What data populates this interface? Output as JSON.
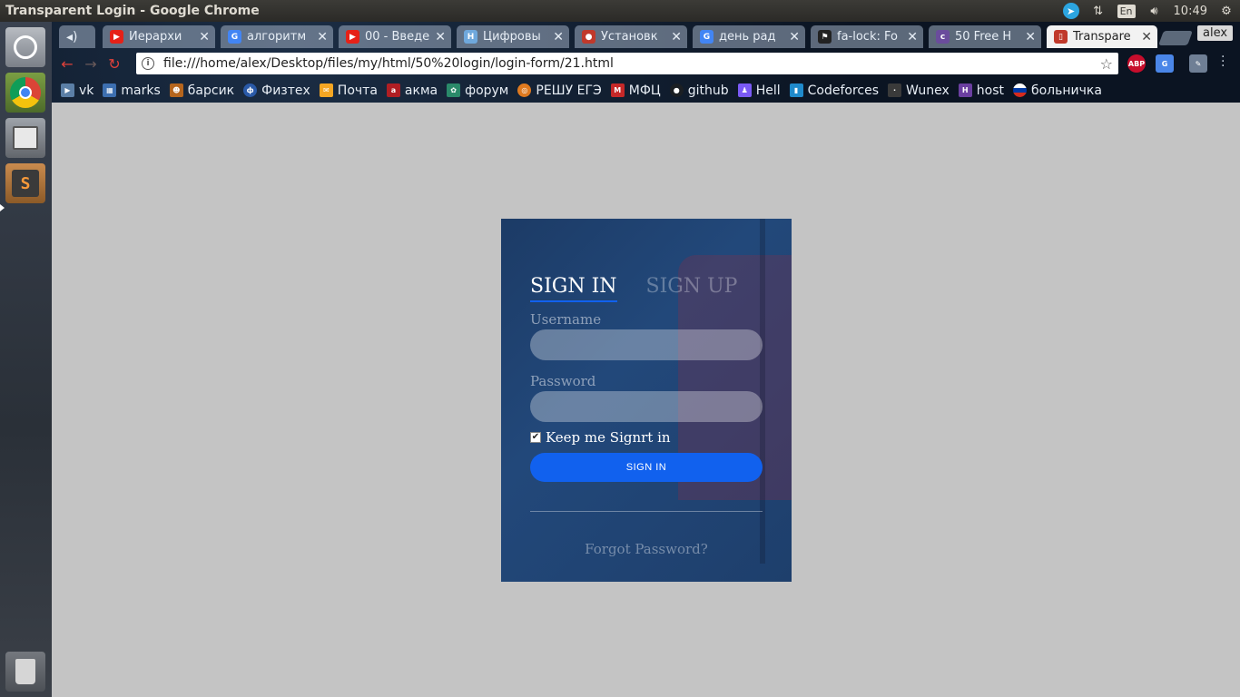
{
  "window": {
    "title": "Transparent Login - Google Chrome"
  },
  "tray": {
    "lang": "En",
    "time": "10:49"
  },
  "launcher": {
    "items": [
      {
        "name": "dash"
      },
      {
        "name": "google-chrome"
      },
      {
        "name": "files"
      },
      {
        "name": "sublime-text",
        "letter": "S"
      },
      {
        "name": "trash"
      }
    ]
  },
  "tabs": [
    {
      "label": "Иерархи",
      "fav_color": "#e62117"
    },
    {
      "label": "алгоритм",
      "fav_color": "#4285f4"
    },
    {
      "label": "00 - Введе",
      "fav_color": "#e62117"
    },
    {
      "label": "Цифровы",
      "fav_color": "#6fa8dc",
      "fav_letter": "H"
    },
    {
      "label": "Установк",
      "fav_color": "#c0392b"
    },
    {
      "label": "день рад",
      "fav_color": "#4285f4"
    },
    {
      "label": "fa-lock: Fo",
      "fav_color": "#222222"
    },
    {
      "label": "50 Free H",
      "fav_color": "#6a4c9c"
    },
    {
      "label": "Transpare",
      "fav_color": "#c0392b",
      "active": true
    }
  ],
  "user": "alex",
  "address": {
    "url": "file:///home/alex/Desktop/files/my/html/50%20login/login-form/21.html"
  },
  "extensions": {
    "abp": "ABP"
  },
  "bookmarks": [
    {
      "label": "vk",
      "fav_color": "#5b7fa6"
    },
    {
      "label": "marks",
      "fav_color": "#3d6fb0"
    },
    {
      "label": "барсик",
      "fav_color": "#b5651d"
    },
    {
      "label": "Физтех",
      "fav_color": "#2a5aa8"
    },
    {
      "label": "Почта",
      "fav_color": "#f5a623"
    },
    {
      "label": "акма",
      "fav_color": "#b01e23"
    },
    {
      "label": "форум",
      "fav_color": "#2a8a6a"
    },
    {
      "label": "РЕШУ ЕГЭ",
      "fav_color": "#e07a1f"
    },
    {
      "label": "МФЦ",
      "fav_color": "#c62828"
    },
    {
      "label": "github",
      "fav_color": "#1b1f23"
    },
    {
      "label": "Hell",
      "fav_color": "#7a5af5"
    },
    {
      "label": "Codeforces",
      "fav_color": "#1f8acb"
    },
    {
      "label": "Wunex",
      "fav_color": "#3a3a3a"
    },
    {
      "label": "host",
      "fav_color": "#6b3fa0"
    },
    {
      "label": "больничка",
      "fav_color": "#d52b1e"
    }
  ],
  "login": {
    "tab_signin": "SIGN IN",
    "tab_signup": "SIGN UP",
    "username_label": "Username",
    "username_value": "",
    "password_label": "Password",
    "password_value": "",
    "keep_signed_in": "Keep me Signrt in",
    "keep_checked": true,
    "button": "SIGN IN",
    "forgot": "Forgot Password?"
  },
  "colors": {
    "accent": "#1161ee",
    "page_bg": "#c4c4c4"
  }
}
